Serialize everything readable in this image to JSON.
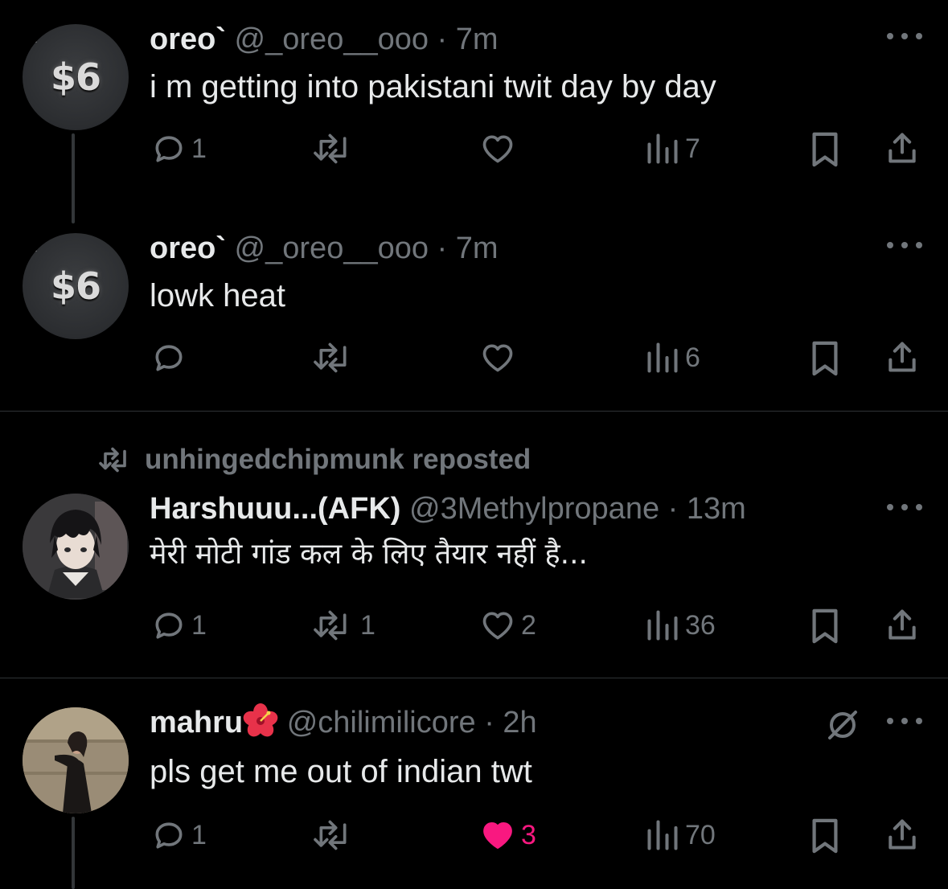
{
  "colors": {
    "background": "#000000",
    "text_primary": "#e7e9ea",
    "text_secondary": "#71767b",
    "divider": "#2f3336",
    "like_active": "#f91880"
  },
  "posts": [
    {
      "avatar_text": "$6",
      "name": "oreo`",
      "meta": " @_oreo__ooo · 7m",
      "text": "i m getting into pakistani twit day by day",
      "replies": "1",
      "reposts": "",
      "likes": "",
      "views": "7",
      "liked": false
    },
    {
      "avatar_text": "$6",
      "name": "oreo`",
      "meta": " @_oreo__ooo · 7m",
      "text": "lowk heat",
      "replies": "",
      "reposts": "",
      "likes": "",
      "views": "6",
      "liked": false
    },
    {
      "repost_label": "unhingedchipmunk reposted",
      "name": "Harshuuu...(AFK)",
      "meta": " @3Methylpropane · 13m",
      "text": "मेरी मोटी गांड कल के लिए तैयार नहीं है...",
      "replies": "1",
      "reposts": "1",
      "likes": "2",
      "views": "36",
      "liked": false
    },
    {
      "name": "mahru",
      "meta": " @chilimilicore · 2h",
      "text": "pls get me out of indian twt",
      "replies": "1",
      "reposts": "",
      "likes": "3",
      "views": "70",
      "liked": true
    }
  ],
  "icons": {
    "reply": "reply-bubble-icon",
    "repost": "repost-arrows-icon",
    "like": "heart-icon",
    "views": "bar-chart-icon",
    "bookmark": "bookmark-icon",
    "share": "share-upload-icon",
    "more": "more-dots-icon",
    "mute": "muted-icon",
    "flower": "hibiscus-emoji"
  }
}
